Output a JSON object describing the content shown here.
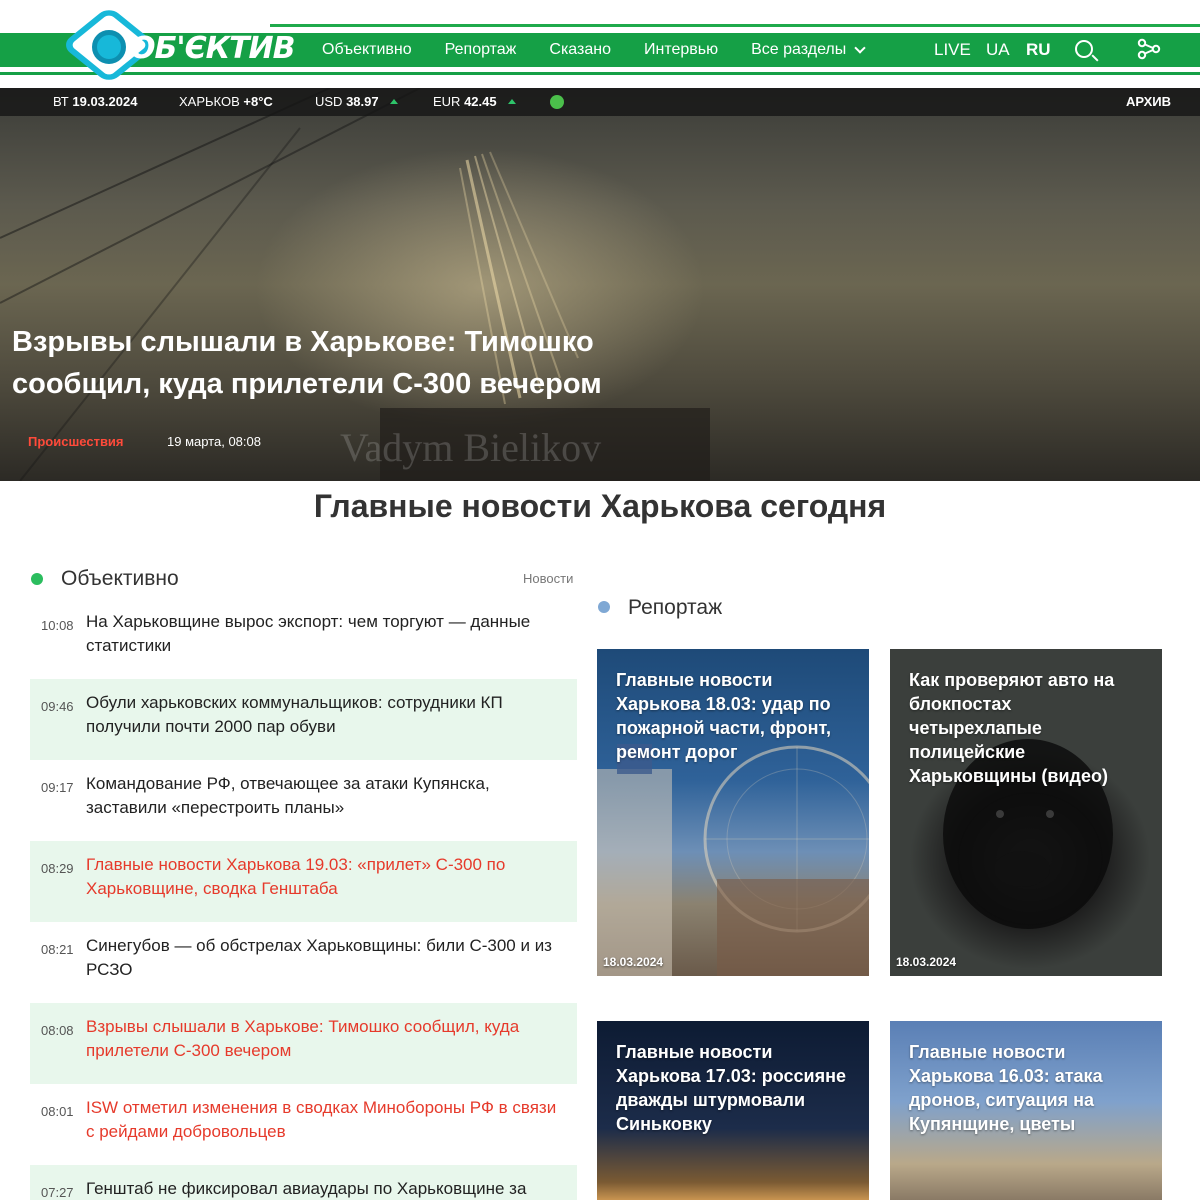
{
  "header": {
    "logo_text": "ОБ'ЄКТИВ",
    "nav": [
      "Объективно",
      "Репортаж",
      "Сказано",
      "Интервью",
      "Все разделы"
    ],
    "live_label": "LIVE",
    "lang_ua": "UA",
    "lang_ru": "RU"
  },
  "infobar": {
    "day": "ВТ",
    "date": "19.03.2024",
    "city": "ХАРЬКОВ",
    "temp": "+8°C",
    "usd_label": "USD",
    "usd_value": "38.97",
    "eur_label": "EUR",
    "eur_value": "42.45",
    "archive": "АРХИВ"
  },
  "hero": {
    "title": "Взрывы слышали в Харькове: Тимошко сообщил, куда прилетели С-300 вечером",
    "category": "Происшествия",
    "date": "19 марта, 08:08",
    "watermark": "Vadym Bielikov"
  },
  "main": {
    "page_title": "Главные новости Харькова сегодня",
    "objectively": {
      "title": "Объективно",
      "link": "Новости",
      "items": [
        {
          "time": "10:08",
          "text": "На Харьковщине вырос экспорт: чем торгуют — данные статистики",
          "highlight": false,
          "shaded": false
        },
        {
          "time": "09:46",
          "text": "Обули харьковских коммунальщиков: сотрудники КП получили почти 2000 пар обуви",
          "highlight": false,
          "shaded": true
        },
        {
          "time": "09:17",
          "text": "Командование РФ, отвечающее за атаки Купянска, заставили «перестроить планы»",
          "highlight": false,
          "shaded": false
        },
        {
          "time": "08:29",
          "text": "Главные новости Харькова 19.03: «прилет» С-300 по Харьковщине, сводка Генштаба",
          "highlight": true,
          "shaded": true
        },
        {
          "time": "08:21",
          "text": "Синегубов — об обстрелах Харьковщины: били С-300 и из РСЗО",
          "highlight": false,
          "shaded": false
        },
        {
          "time": "08:08",
          "text": "Взрывы слышали в Харькове: Тимошко сообщил, куда прилетели С-300 вечером",
          "highlight": true,
          "shaded": true
        },
        {
          "time": "08:01",
          "text": "ISW отметил изменения в сводках Минобороны РФ в связи с рейдами добровольцев",
          "highlight": true,
          "shaded": false
        },
        {
          "time": "07:27",
          "text": "Генштаб не фиксировал авиаудары по Харьковщине за",
          "highlight": false,
          "shaded": true
        }
      ]
    },
    "reportage": {
      "title": "Репортаж",
      "cards": [
        {
          "title": "Главные новости Харькова 18.03: удар по пожарной части, фронт, ремонт дорог",
          "date": "18.03.2024"
        },
        {
          "title": "Как проверяют авто на блокпостах четырехлапые полицейские Харьковщины (видео)",
          "date": "18.03.2024"
        },
        {
          "title": "Главные новости Харькова 17.03: россияне дважды штурмовали Синьковку",
          "date": ""
        },
        {
          "title": "Главные новости Харькова 16.03: атака дронов, ситуация на Купянщине, цветы",
          "date": ""
        }
      ]
    }
  },
  "colors": {
    "brand_green": "#15a046",
    "logo_blue": "#17b8d9",
    "highlight_red": "#e63a2b",
    "shaded_row": "#e8f7ec",
    "dot_green": "#2bbd5e",
    "dot_blue": "#7fa8d4"
  },
  "icons": [
    "search-icon",
    "share-icon",
    "chevron-down-icon",
    "up-arrow-icon"
  ]
}
